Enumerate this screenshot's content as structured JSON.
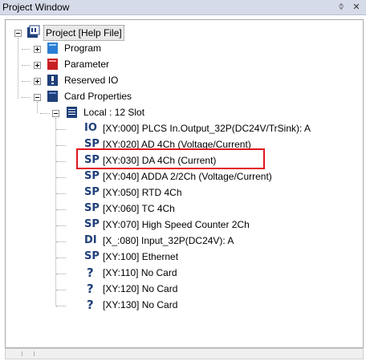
{
  "window": {
    "title": "Project Window",
    "pin_glyph": "ᛰ",
    "close_glyph": "✕"
  },
  "tree": {
    "root": "Project [Help File]",
    "program": "Program",
    "parameter": "Parameter",
    "reserved_io": "Reserved IO",
    "card_properties": "Card Properties",
    "local": "Local : 12 Slot",
    "cards": [
      {
        "icon_text": "IO",
        "label": "[XY:000] PLCS In.Output_32P(DC24V/TrSink): A"
      },
      {
        "icon_text": "SP",
        "label": "[XY:020] AD 4Ch (Voltage/Current)"
      },
      {
        "icon_text": "SP",
        "label": "[XY:030] DA 4Ch (Current)"
      },
      {
        "icon_text": "SP",
        "label": "[XY:040] ADDA 2/2Ch (Voltage/Current)"
      },
      {
        "icon_text": "SP",
        "label": "[XY:050] RTD 4Ch"
      },
      {
        "icon_text": "SP",
        "label": "[XY:060] TC 4Ch"
      },
      {
        "icon_text": "SP",
        "label": "[XY:070] High Speed Counter 2Ch"
      },
      {
        "icon_text": "DI",
        "label": "[X_:080] Input_32P(DC24V): A"
      },
      {
        "icon_text": "SP",
        "label": "[XY:100] Ethernet"
      },
      {
        "icon_text": "?",
        "label": "[XY:110] No Card"
      },
      {
        "icon_text": "?",
        "label": "[XY:120] No Card"
      },
      {
        "icon_text": "?",
        "label": "[XY:130] No Card"
      }
    ]
  }
}
